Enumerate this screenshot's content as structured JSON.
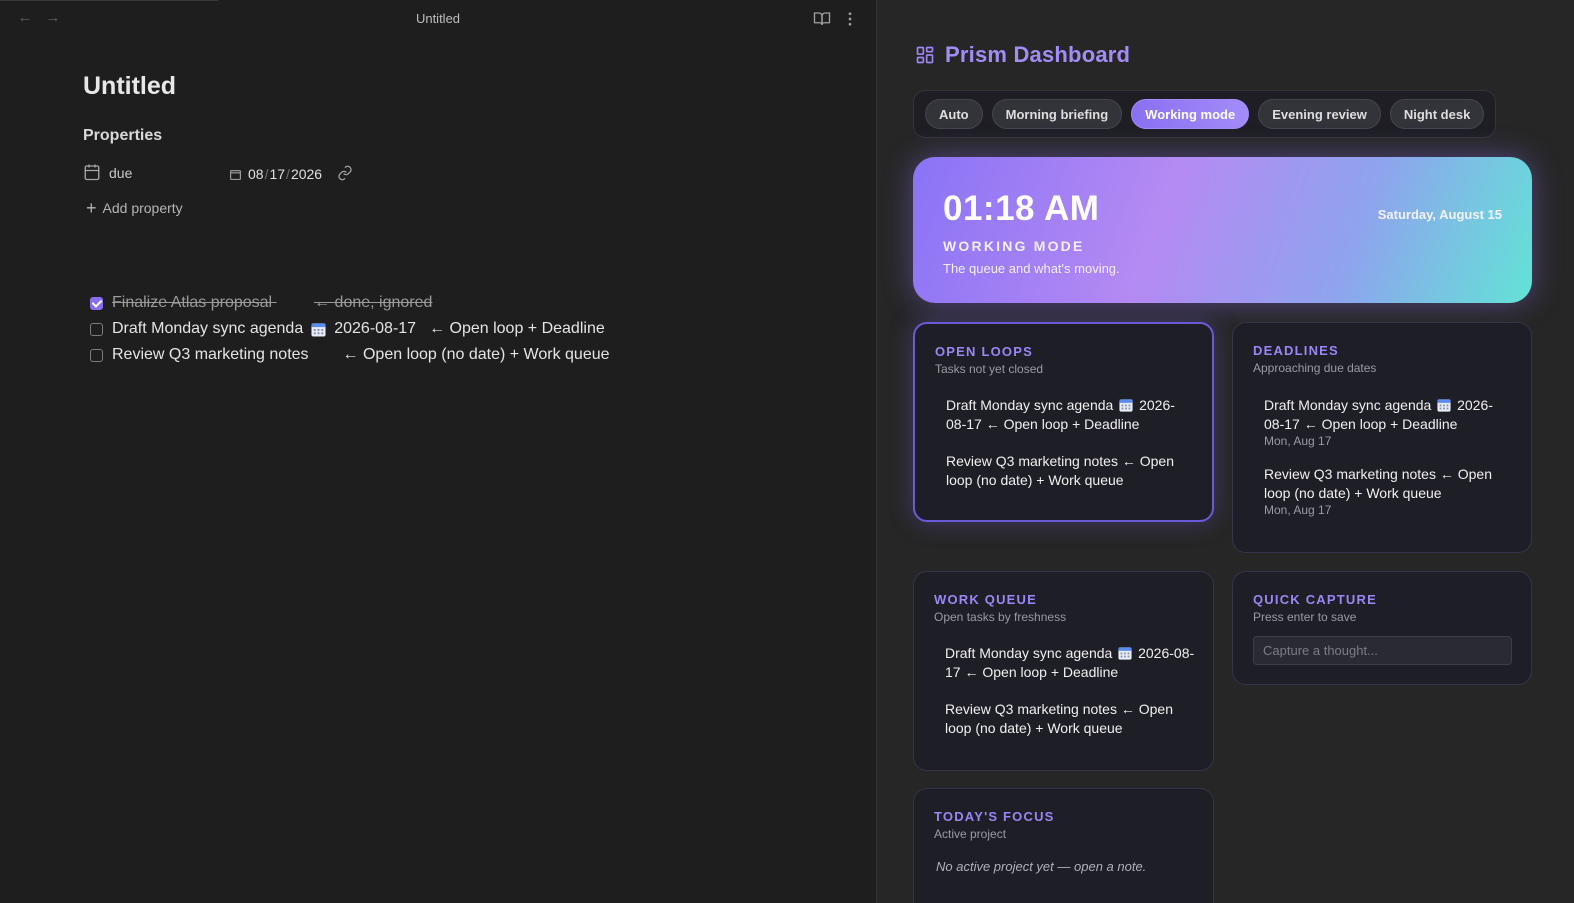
{
  "editor": {
    "view_title": "Untitled",
    "note_title": "Untitled",
    "properties_heading": "Properties",
    "property": {
      "key": "due",
      "month": "08",
      "day": "17",
      "year": "2026",
      "sep": "/"
    },
    "add_property": "Add property",
    "tasks": [
      {
        "text": "Finalize Atlas proposal",
        "note": "← done, ignored",
        "checked": true
      },
      {
        "text": "Draft Monday sync agenda",
        "date": "2026-08-17",
        "note": "← Open loop + Deadline",
        "checked": false
      },
      {
        "text": "Review Q3 marketing notes",
        "note": "← Open loop (no date) + Work queue",
        "checked": false
      }
    ]
  },
  "dashboard": {
    "title": "Prism Dashboard",
    "modes": [
      "Auto",
      "Morning briefing",
      "Working mode",
      "Evening review",
      "Night desk"
    ],
    "active_mode": "Working mode",
    "hero": {
      "time": "01:18 AM",
      "date": "Saturday, August 15",
      "mode": "WORKING MODE",
      "subtitle": "The queue and what's moving."
    },
    "open_loops": {
      "title": "OPEN LOOPS",
      "subtitle": "Tasks not yet closed",
      "items": [
        {
          "before": "Draft Monday sync agenda",
          "after": "2026-08-17 ← Open loop + Deadline"
        },
        {
          "before": "Review Q3 marketing notes ← Open loop (no date) + Work queue"
        }
      ]
    },
    "deadlines": {
      "title": "DEADLINES",
      "subtitle": "Approaching due dates",
      "items": [
        {
          "before": "Draft Monday sync agenda",
          "after": "2026-08-17 ← Open loop + Deadline",
          "due": "Mon, Aug 17"
        },
        {
          "before": "Review Q3 marketing notes ← Open loop (no date) + Work queue",
          "due": "Mon, Aug 17"
        }
      ]
    },
    "work_queue": {
      "title": "WORK QUEUE",
      "subtitle": "Open tasks by freshness",
      "items": [
        {
          "before": "Draft Monday sync agenda",
          "after": "2026-08-17 ← Open loop + Deadline"
        },
        {
          "before": "Review Q3 marketing notes ← Open loop (no date) + Work queue"
        }
      ]
    },
    "quick_capture": {
      "title": "QUICK CAPTURE",
      "subtitle": "Press enter to save",
      "placeholder": "Capture a thought..."
    },
    "todays_focus": {
      "title": "TODAY'S FOCUS",
      "subtitle": "Active project",
      "empty": "No active project yet — open a note."
    },
    "colors": {
      "accent": "#9b86f6",
      "hero_start": "#8a73f6",
      "hero_end": "#62e3d6"
    }
  }
}
